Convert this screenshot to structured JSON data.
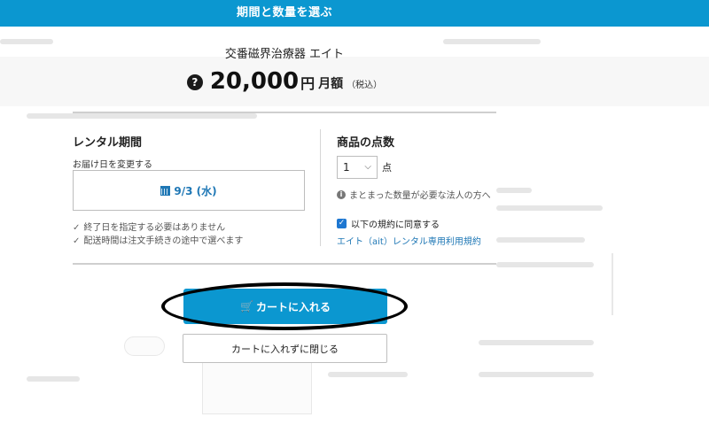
{
  "header": {
    "title": "期間と数量を選ぶ"
  },
  "product": {
    "name": "交番磁界治療器 エイト",
    "price": "20,000",
    "price_unit": "円",
    "price_period": "月額",
    "price_tax": "（税込）",
    "help_icon_glyph": "?"
  },
  "rental": {
    "title": "レンタル期間",
    "change_label": "お届け日を変更する",
    "date_value": "9/3 (水)",
    "notes": [
      "終了日を指定する必要はありません",
      "配送時間は注文手続きの途中で選べます"
    ],
    "check_glyph": "✓"
  },
  "quantity": {
    "title": "商品の点数",
    "selected": "1",
    "unit": "点",
    "info_text": "まとまった数量が必要な法人の方へ",
    "info_glyph": "i",
    "chevron_glyph": "⌵"
  },
  "terms": {
    "agree_label": "以下の規約に同意する",
    "checked_glyph": "✓",
    "link_text": "エイト（ait）レンタル専用利用規約"
  },
  "actions": {
    "cart_label": "カートに入れる",
    "cart_icon_glyph": "🛒",
    "close_label": "カートに入れずに閉じる"
  },
  "colors": {
    "accent": "#0b97d0",
    "link": "#1e77b5",
    "checkbox": "#1e77d1"
  },
  "icons": {
    "help": "help-icon",
    "calendar": "calendar-icon",
    "check": "check-icon",
    "info": "info-icon",
    "cart": "cart-icon",
    "chevron": "chevron-down-icon"
  }
}
